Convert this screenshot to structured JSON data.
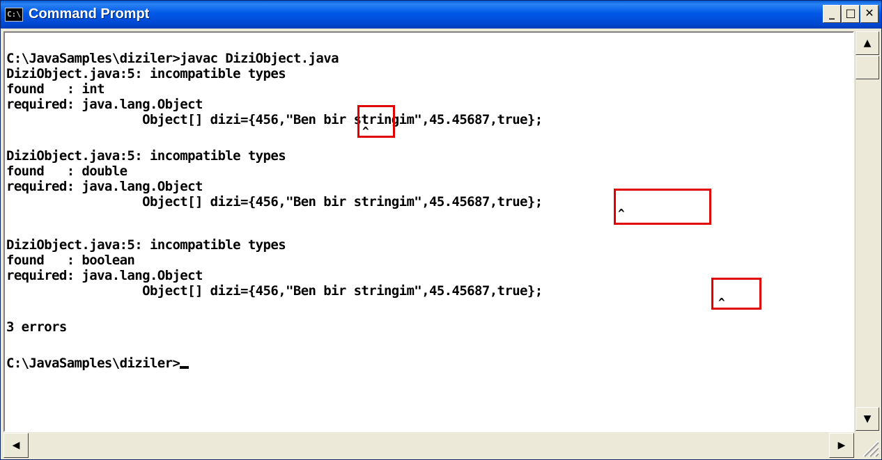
{
  "window": {
    "title": "Command Prompt",
    "icon": "console-app-icon",
    "icon_text": "C:\\",
    "controls": {
      "minimize": "_",
      "maximize": "□",
      "close": "✕"
    }
  },
  "console": {
    "lines": [
      "C:\\JavaSamples\\diziler>javac DiziObject.java",
      "DiziObject.java:5: incompatible types",
      "found   : int",
      "required: java.lang.Object",
      "                  Object[] dizi={456,\"Ben bir stringim\",45.45687,true};",
      "^",
      "DiziObject.java:5: incompatible types",
      "found   : double",
      "required: java.lang.Object",
      "                  Object[] dizi={456,\"Ben bir stringim\",45.45687,true};",
      "^",
      "DiziObject.java:5: incompatible types",
      "found   : boolean",
      "required: java.lang.Object",
      "                  Object[] dizi={456,\"Ben bir stringim\",45.45687,true};",
      "^",
      "3 errors",
      "C:\\JavaSamples\\diziler>"
    ],
    "highlights": [
      "456",
      "45.45687",
      "true"
    ],
    "highlight_color": "#e00000"
  },
  "scrollbars": {
    "up_arrow": "▲",
    "down_arrow": "▼",
    "left_arrow": "◀",
    "right_arrow": "▶"
  }
}
